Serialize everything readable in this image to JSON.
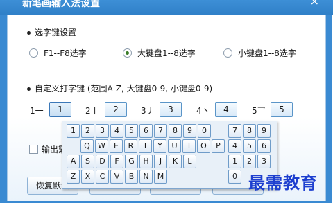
{
  "window": {
    "title": "新笔画输入法设置",
    "close_glyph": "×"
  },
  "select_keys": {
    "heading": "选字键设置",
    "options": [
      {
        "label": "F1--F8选字",
        "checked": false
      },
      {
        "label": "大键盘1--8选字",
        "checked": true
      },
      {
        "label": "小键盘1--8选字",
        "checked": false
      }
    ]
  },
  "custom_keys": {
    "heading": "自定义打字键 (范围A-Z, 大键盘0-9, 小键盘0-9)",
    "keys": [
      {
        "label": "1一",
        "value": "1"
      },
      {
        "label": "2丨",
        "value": "2"
      },
      {
        "label": "3丿",
        "value": "3"
      },
      {
        "label": "4丶",
        "value": "4"
      },
      {
        "label": "5乛",
        "value": "5"
      }
    ]
  },
  "checkbox": {
    "label": "输出繁",
    "checked": false
  },
  "buttons": {
    "restore_default": "恢复默认"
  },
  "soft_keyboard": {
    "row1": [
      "1",
      "2",
      "3",
      "4",
      "5",
      "6",
      "7",
      "8",
      "9",
      "0"
    ],
    "row2": [
      "Q",
      "W",
      "E",
      "R",
      "T",
      "Y",
      "U",
      "I",
      "O",
      "P"
    ],
    "row3": [
      "A",
      "S",
      "D",
      "F",
      "G",
      "H",
      "J",
      "K",
      "L"
    ],
    "row4": [
      "Z",
      "X",
      "C",
      "V",
      "B",
      "N",
      "M"
    ],
    "numpad": [
      [
        "7",
        "8",
        "9"
      ],
      [
        "4",
        "5",
        "6"
      ],
      [
        "1",
        "2",
        "3"
      ],
      [
        "0"
      ]
    ]
  },
  "watermark": "最需教育"
}
